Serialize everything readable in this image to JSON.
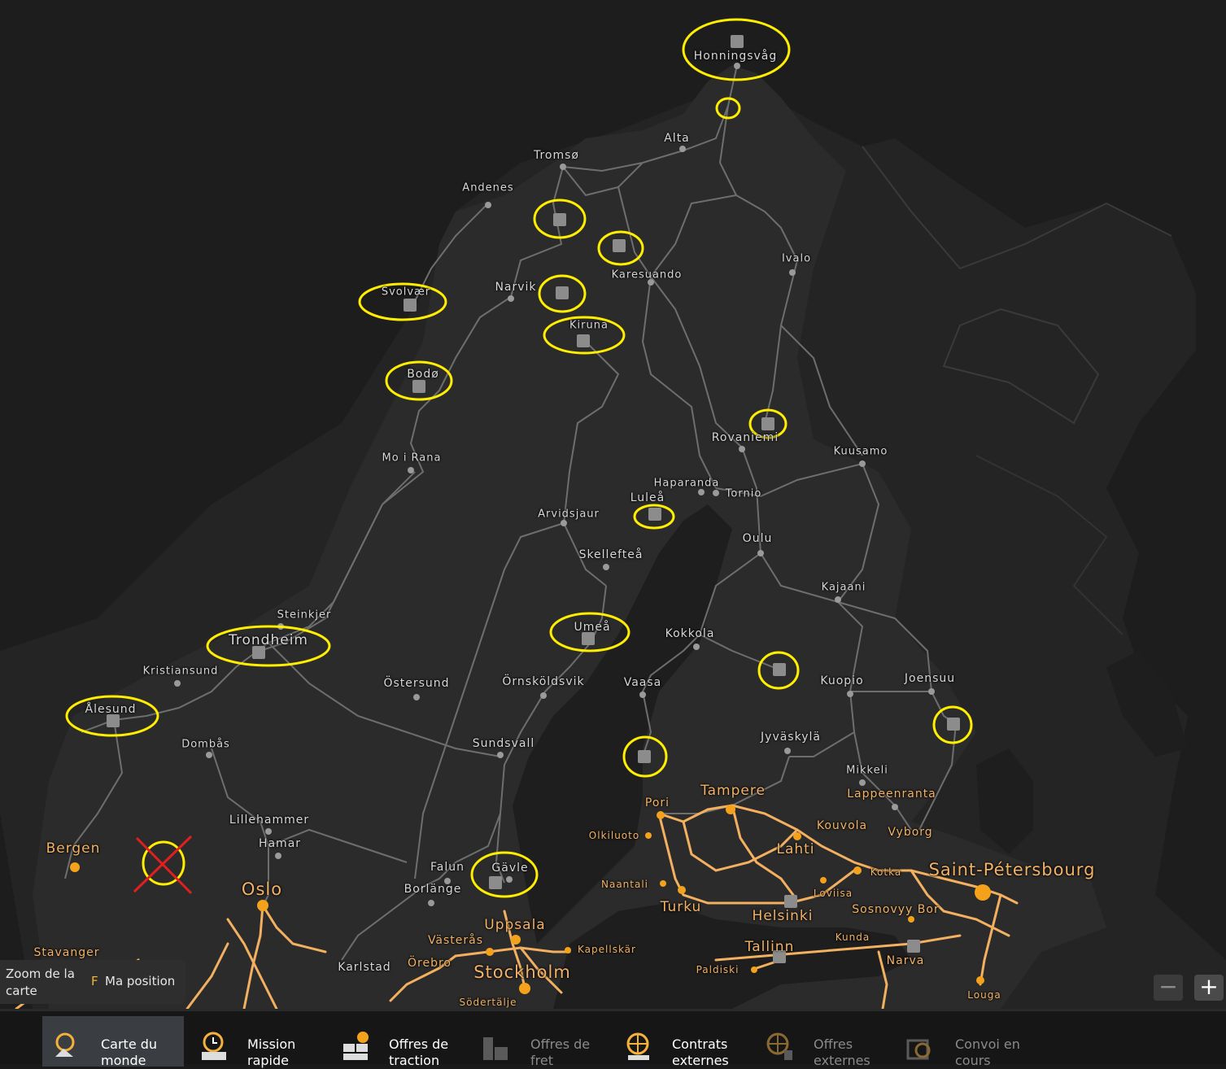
{
  "cities": [
    {
      "name": "Honningsvåg"
    },
    {
      "name": "Alta"
    },
    {
      "name": "Tromsø"
    },
    {
      "name": "Andenes"
    },
    {
      "name": "Ivalo"
    },
    {
      "name": "Karesuando"
    },
    {
      "name": "Svolvær"
    },
    {
      "name": "Narvik"
    },
    {
      "name": "Kiruna"
    },
    {
      "name": "Bodø"
    },
    {
      "name": "Rovaniemi"
    },
    {
      "name": "Kuusamo"
    },
    {
      "name": "Mo i Rana"
    },
    {
      "name": "Haparanda"
    },
    {
      "name": "Tornio"
    },
    {
      "name": "Luleå"
    },
    {
      "name": "Arvidsjaur"
    },
    {
      "name": "Oulu"
    },
    {
      "name": "Skellefteå"
    },
    {
      "name": "Kajaani"
    },
    {
      "name": "Steinkjer"
    },
    {
      "name": "Umeå"
    },
    {
      "name": "Kokkola"
    },
    {
      "name": "Trondheim"
    },
    {
      "name": "Kristiansund"
    },
    {
      "name": "Östersund"
    },
    {
      "name": "Örnsköldsvik"
    },
    {
      "name": "Vaasa"
    },
    {
      "name": "Kuopio"
    },
    {
      "name": "Joensuu"
    },
    {
      "name": "Ålesund"
    },
    {
      "name": "Jyväskylä"
    },
    {
      "name": "Sundsvall"
    },
    {
      "name": "Dombås"
    },
    {
      "name": "Mikkeli"
    },
    {
      "name": "Tampere"
    },
    {
      "name": "Lappeenranta"
    },
    {
      "name": "Pori"
    },
    {
      "name": "Lillehammer"
    },
    {
      "name": "Kouvola"
    },
    {
      "name": "Olkiluoto"
    },
    {
      "name": "Vyborg"
    },
    {
      "name": "Bergen"
    },
    {
      "name": "Hamar"
    },
    {
      "name": "Lahti"
    },
    {
      "name": "Falun"
    },
    {
      "name": "Gävle"
    },
    {
      "name": "Kotka"
    },
    {
      "name": "Saint-Pétersbourg"
    },
    {
      "name": "Naantali"
    },
    {
      "name": "Oslo"
    },
    {
      "name": "Borlänge"
    },
    {
      "name": "Loviisa"
    },
    {
      "name": "Turku"
    },
    {
      "name": "Sosnovyy Bor"
    },
    {
      "name": "Helsinki"
    },
    {
      "name": "Uppsala"
    },
    {
      "name": "Västerås"
    },
    {
      "name": "Kunda"
    },
    {
      "name": "Stavanger"
    },
    {
      "name": "Kapellskär"
    },
    {
      "name": "Tallinn"
    },
    {
      "name": "Örebro"
    },
    {
      "name": "Karlstad"
    },
    {
      "name": "Narva"
    },
    {
      "name": "Stockholm"
    },
    {
      "name": "Paldiski"
    },
    {
      "name": "Louga"
    },
    {
      "name": "Södertälje"
    }
  ],
  "zoom_panel": {
    "zoom_label": "Zoom de la carte",
    "position_key": "F",
    "position_label": "Ma position"
  },
  "zoom_controls": {
    "minus": "−",
    "plus": "+"
  },
  "tabs": [
    {
      "label": "Carte du monde",
      "icon": "world-map-icon",
      "active": true
    },
    {
      "label": "Mission rapide",
      "icon": "quick-job-icon",
      "active": false
    },
    {
      "label": "Offres de traction",
      "icon": "freight-market-icon",
      "active": false
    },
    {
      "label": "Offres de fret",
      "icon": "cargo-market-icon",
      "active": false,
      "disabled": true
    },
    {
      "label": "Contrats externes",
      "icon": "external-contracts-icon",
      "active": false
    },
    {
      "label": "Offres externes",
      "icon": "external-offers-icon",
      "active": false,
      "disabled": true
    },
    {
      "label": "Convoi en cours",
      "icon": "convoy-icon",
      "active": false,
      "disabled": true
    }
  ],
  "colors": {
    "annotation_circle": "#ffee00",
    "cross": "#e02020",
    "active_road": "#f2b060",
    "road": "#7a7a7a",
    "land": "#2b2b2b",
    "water": "#1c1c1c"
  }
}
